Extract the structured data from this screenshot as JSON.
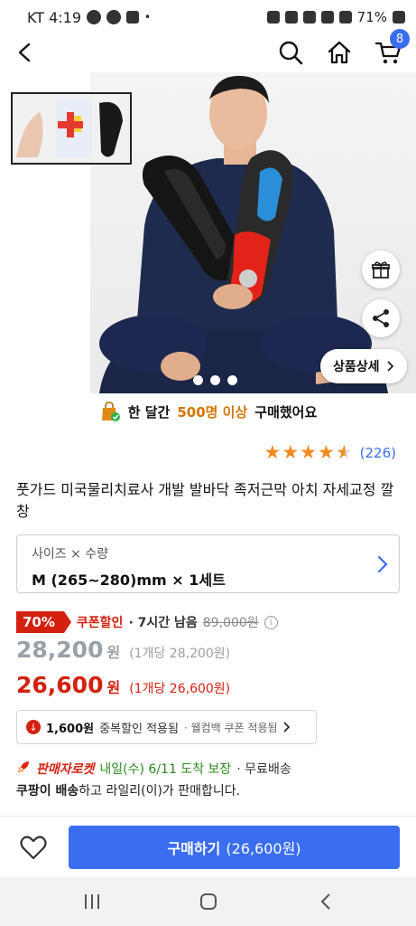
{
  "status_bar": {
    "carrier_time": "KT 4:19",
    "battery": "71%"
  },
  "nav": {
    "cart_count": "8"
  },
  "hero": {
    "detail_button": "상품상세",
    "page_count": 3
  },
  "purchase_stat": {
    "prefix": "한 달간",
    "highlight": "500명 이상",
    "suffix": "구매했어요"
  },
  "rating": {
    "stars": 4.5,
    "count": "(226)"
  },
  "product": {
    "title": "풋가드 미국물리치료사 개발 발바닥 족저근막 아치 자세교정 깔창"
  },
  "option": {
    "label": "사이즈 × 수량",
    "value": "M (265~280)mm × 1세트"
  },
  "pricing": {
    "discount_pct": "70%",
    "coupon_label": "쿠폰할인",
    "time_left": "· 7시간 남음",
    "original_price": "89,000원",
    "price_before": "28,200",
    "won": "원",
    "price_before_unit": "(1개당 28,200원)",
    "price_final": "26,600",
    "price_final_unit": "(1개당 26,600원)",
    "dup_amount": "1,600원",
    "dup_text": "중복할인 적용됨",
    "dup_sub": "· 웰컴백 쿠폰 적용됨"
  },
  "delivery": {
    "label": "판매자로켓",
    "arrival": "내일(수) 6/11 도착 보장",
    "shipping": "· 무료배송",
    "seller_bold": "쿠팡이 배송",
    "seller_rest": "하고 라일리(이)가 판매합니다."
  },
  "action_bar": {
    "buy_label": "구매하기",
    "buy_amount": "(26,600원)"
  },
  "colors": {
    "accent_blue": "#3a6df0",
    "discount_red": "#d4200f",
    "arrival_green": "#2b8a1e",
    "star_orange": "#f18a20"
  }
}
